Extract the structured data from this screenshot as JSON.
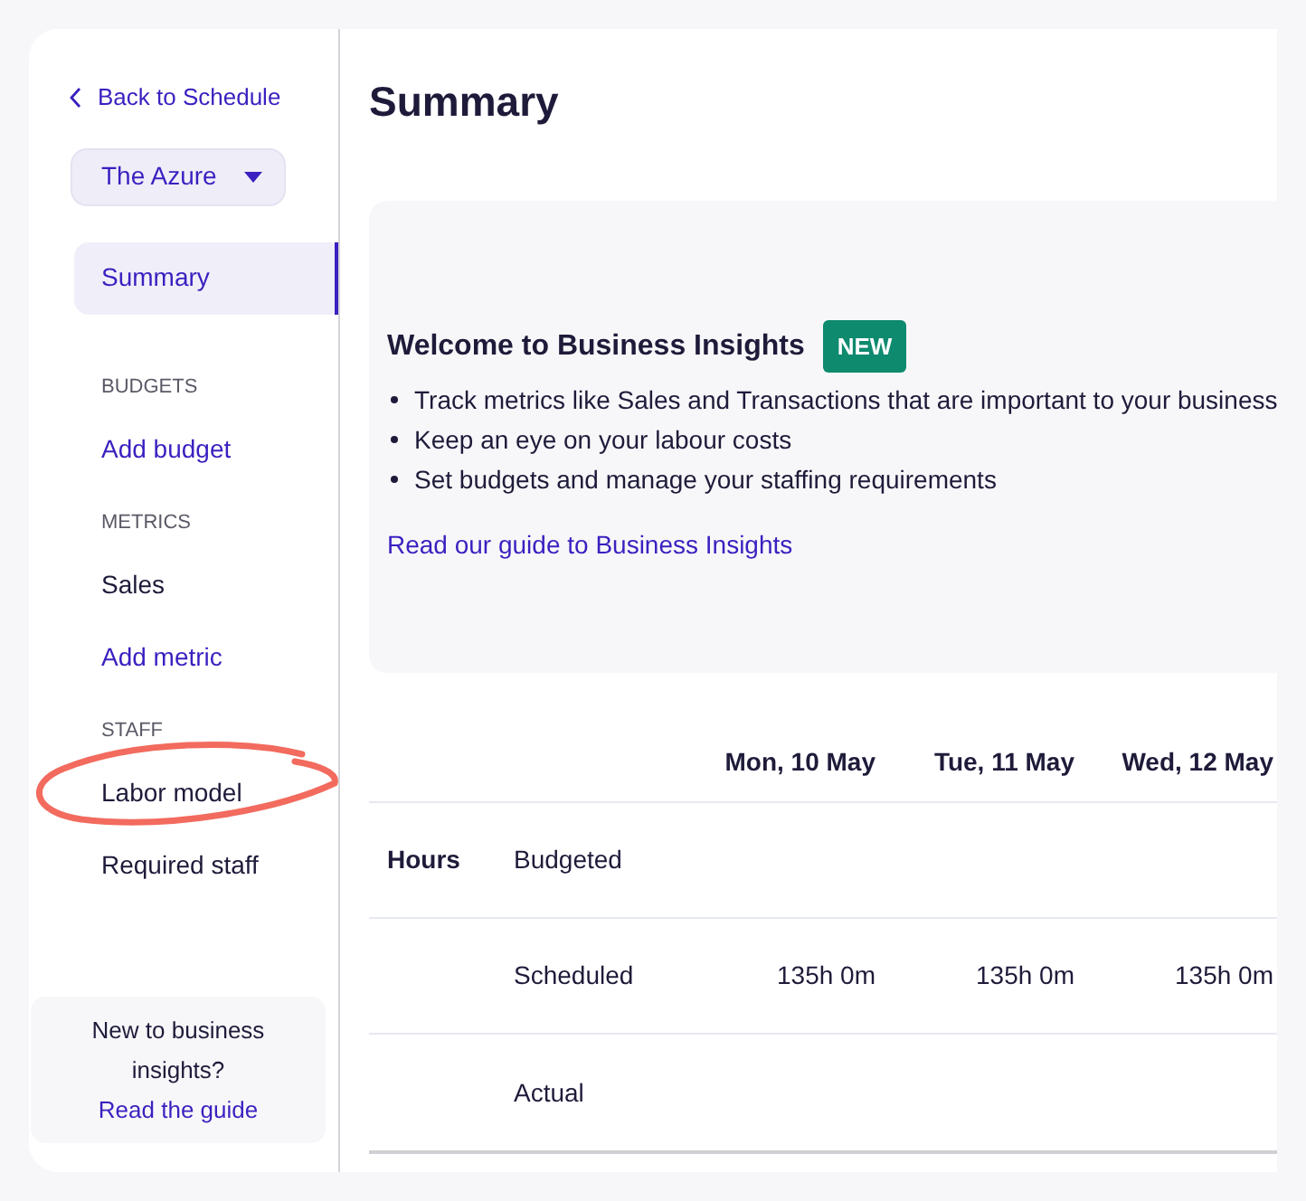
{
  "sidebar": {
    "back_link": "Back to Schedule",
    "location_dropdown": "The Azure",
    "items": [
      {
        "kind": "nav",
        "label": "Summary",
        "selected": true
      },
      {
        "kind": "section",
        "label": "BUDGETS"
      },
      {
        "kind": "action",
        "label": "Add budget"
      },
      {
        "kind": "section",
        "label": "METRICS"
      },
      {
        "kind": "nav",
        "label": "Sales",
        "selected": false
      },
      {
        "kind": "action",
        "label": "Add metric"
      },
      {
        "kind": "section",
        "label": "STAFF"
      },
      {
        "kind": "nav",
        "label": "Labor model",
        "selected": false,
        "annotated": true
      },
      {
        "kind": "nav",
        "label": "Required staff",
        "selected": false
      }
    ],
    "help_box": {
      "text": "New to business insights?",
      "link": "Read the guide"
    }
  },
  "main": {
    "title": "Summary",
    "banner": {
      "heading": "Welcome to Business Insights",
      "badge": "NEW",
      "bullets": [
        "Track metrics like Sales and Transactions that are important to your business",
        "Keep an eye on your labour costs",
        "Set budgets and manage your staffing requirements"
      ],
      "link": "Read our guide to Business Insights"
    },
    "table": {
      "columns": [
        "Mon, 10 May",
        "Tue, 11 May",
        "Wed, 12 May"
      ],
      "group": "Hours",
      "rows": [
        {
          "label": "Budgeted"
        },
        {
          "label": "Scheduled",
          "values": [
            "135h 0m",
            "135h 0m",
            "135h 0m"
          ]
        },
        {
          "label": "Actual"
        }
      ]
    }
  }
}
